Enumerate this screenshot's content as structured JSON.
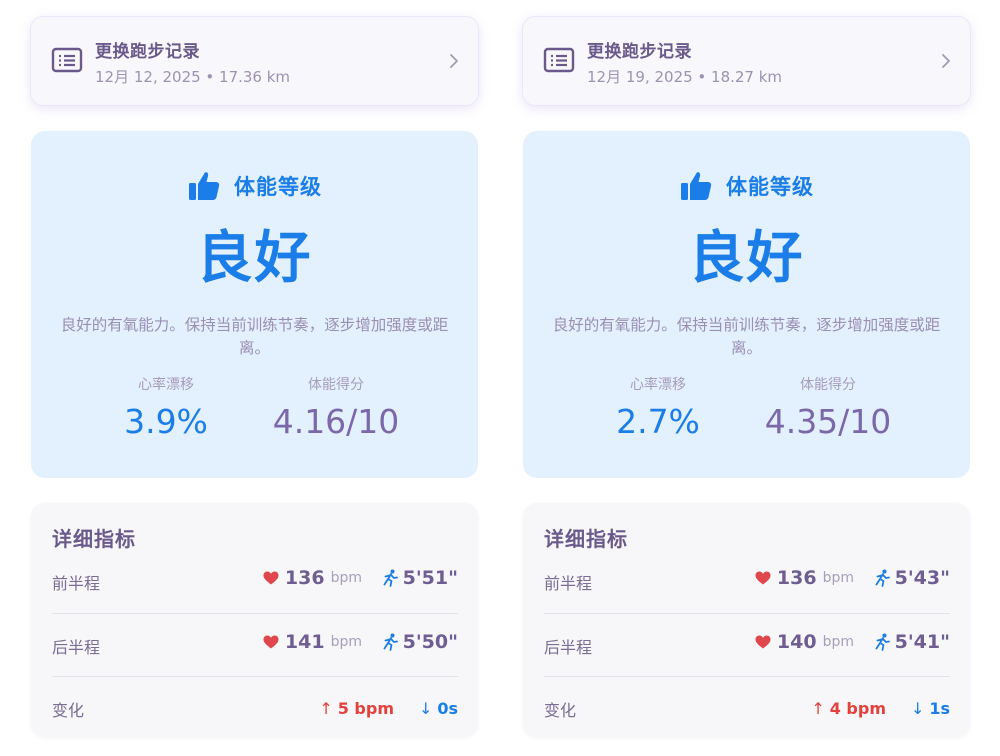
{
  "colors": {
    "accent_blue": "#1a7de8",
    "purple_text": "#6a5a8c",
    "up_red": "#e3413c",
    "card_blue": "#e3f0fd",
    "heart_red": "#e0474c"
  },
  "icons": {
    "record": "list-document-icon",
    "thumb": "thumbs-up-icon",
    "heart": "heart-icon",
    "runner": "running-person-icon",
    "chevron": "chevron-right-icon"
  },
  "left": {
    "record": {
      "title": "更换跑步记录",
      "subtitle": "12月 12, 2025 • 17.36 km"
    },
    "fitness": {
      "heading": "体能等级",
      "level": "良好",
      "description": "良好的有氧能力。保持当前训练节奏，逐步增加强度或距离。",
      "drift_label": "心率漂移",
      "drift_value": "3.9%",
      "score_label": "体能得分",
      "score_value": "4.16/10"
    },
    "details": {
      "title": "详细指标",
      "rows": [
        {
          "label": "前半程",
          "hr": "136",
          "hr_unit": "bpm",
          "pace": "5'51\""
        },
        {
          "label": "后半程",
          "hr": "141",
          "hr_unit": "bpm",
          "pace": "5'50\""
        }
      ],
      "change": {
        "label": "变化",
        "hr_arrow": "↑",
        "hr_change": "5 bpm",
        "pace_arrow": "↓",
        "pace_change": "0s"
      }
    }
  },
  "right": {
    "record": {
      "title": "更换跑步记录",
      "subtitle": "12月 19, 2025 • 18.27 km"
    },
    "fitness": {
      "heading": "体能等级",
      "level": "良好",
      "description": "良好的有氧能力。保持当前训练节奏，逐步增加强度或距离。",
      "drift_label": "心率漂移",
      "drift_value": "2.7%",
      "score_label": "体能得分",
      "score_value": "4.35/10"
    },
    "details": {
      "title": "详细指标",
      "rows": [
        {
          "label": "前半程",
          "hr": "136",
          "hr_unit": "bpm",
          "pace": "5'43\""
        },
        {
          "label": "后半程",
          "hr": "140",
          "hr_unit": "bpm",
          "pace": "5'41\""
        }
      ],
      "change": {
        "label": "变化",
        "hr_arrow": "↑",
        "hr_change": "4 bpm",
        "pace_arrow": "↓",
        "pace_change": "1s"
      }
    }
  }
}
